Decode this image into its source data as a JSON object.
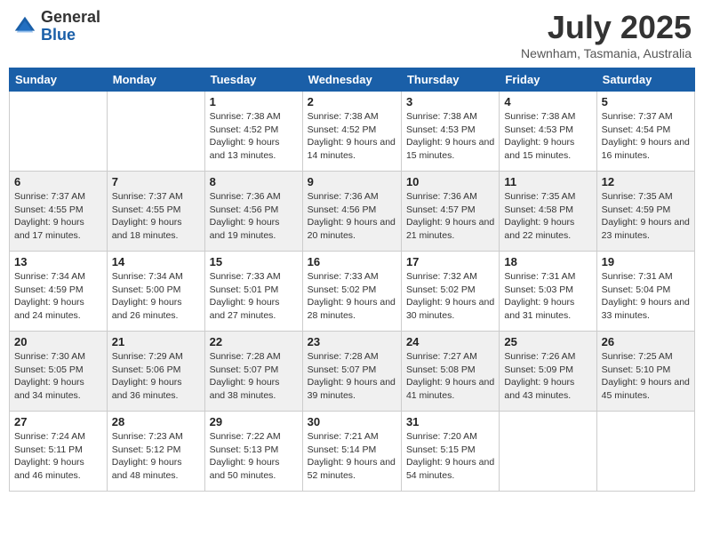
{
  "logo": {
    "general": "General",
    "blue": "Blue"
  },
  "title": {
    "month_year": "July 2025",
    "location": "Newnham, Tasmania, Australia"
  },
  "days_of_week": [
    "Sunday",
    "Monday",
    "Tuesday",
    "Wednesday",
    "Thursday",
    "Friday",
    "Saturday"
  ],
  "weeks": [
    [
      {
        "day": "",
        "detail": ""
      },
      {
        "day": "",
        "detail": ""
      },
      {
        "day": "1",
        "sunrise": "7:38 AM",
        "sunset": "4:52 PM",
        "daylight": "9 hours and 13 minutes."
      },
      {
        "day": "2",
        "sunrise": "7:38 AM",
        "sunset": "4:52 PM",
        "daylight": "9 hours and 14 minutes."
      },
      {
        "day": "3",
        "sunrise": "7:38 AM",
        "sunset": "4:53 PM",
        "daylight": "9 hours and 15 minutes."
      },
      {
        "day": "4",
        "sunrise": "7:38 AM",
        "sunset": "4:53 PM",
        "daylight": "9 hours and 15 minutes."
      },
      {
        "day": "5",
        "sunrise": "7:37 AM",
        "sunset": "4:54 PM",
        "daylight": "9 hours and 16 minutes."
      }
    ],
    [
      {
        "day": "6",
        "sunrise": "7:37 AM",
        "sunset": "4:55 PM",
        "daylight": "9 hours and 17 minutes."
      },
      {
        "day": "7",
        "sunrise": "7:37 AM",
        "sunset": "4:55 PM",
        "daylight": "9 hours and 18 minutes."
      },
      {
        "day": "8",
        "sunrise": "7:36 AM",
        "sunset": "4:56 PM",
        "daylight": "9 hours and 19 minutes."
      },
      {
        "day": "9",
        "sunrise": "7:36 AM",
        "sunset": "4:56 PM",
        "daylight": "9 hours and 20 minutes."
      },
      {
        "day": "10",
        "sunrise": "7:36 AM",
        "sunset": "4:57 PM",
        "daylight": "9 hours and 21 minutes."
      },
      {
        "day": "11",
        "sunrise": "7:35 AM",
        "sunset": "4:58 PM",
        "daylight": "9 hours and 22 minutes."
      },
      {
        "day": "12",
        "sunrise": "7:35 AM",
        "sunset": "4:59 PM",
        "daylight": "9 hours and 23 minutes."
      }
    ],
    [
      {
        "day": "13",
        "sunrise": "7:34 AM",
        "sunset": "4:59 PM",
        "daylight": "9 hours and 24 minutes."
      },
      {
        "day": "14",
        "sunrise": "7:34 AM",
        "sunset": "5:00 PM",
        "daylight": "9 hours and 26 minutes."
      },
      {
        "day": "15",
        "sunrise": "7:33 AM",
        "sunset": "5:01 PM",
        "daylight": "9 hours and 27 minutes."
      },
      {
        "day": "16",
        "sunrise": "7:33 AM",
        "sunset": "5:02 PM",
        "daylight": "9 hours and 28 minutes."
      },
      {
        "day": "17",
        "sunrise": "7:32 AM",
        "sunset": "5:02 PM",
        "daylight": "9 hours and 30 minutes."
      },
      {
        "day": "18",
        "sunrise": "7:31 AM",
        "sunset": "5:03 PM",
        "daylight": "9 hours and 31 minutes."
      },
      {
        "day": "19",
        "sunrise": "7:31 AM",
        "sunset": "5:04 PM",
        "daylight": "9 hours and 33 minutes."
      }
    ],
    [
      {
        "day": "20",
        "sunrise": "7:30 AM",
        "sunset": "5:05 PM",
        "daylight": "9 hours and 34 minutes."
      },
      {
        "day": "21",
        "sunrise": "7:29 AM",
        "sunset": "5:06 PM",
        "daylight": "9 hours and 36 minutes."
      },
      {
        "day": "22",
        "sunrise": "7:28 AM",
        "sunset": "5:07 PM",
        "daylight": "9 hours and 38 minutes."
      },
      {
        "day": "23",
        "sunrise": "7:28 AM",
        "sunset": "5:07 PM",
        "daylight": "9 hours and 39 minutes."
      },
      {
        "day": "24",
        "sunrise": "7:27 AM",
        "sunset": "5:08 PM",
        "daylight": "9 hours and 41 minutes."
      },
      {
        "day": "25",
        "sunrise": "7:26 AM",
        "sunset": "5:09 PM",
        "daylight": "9 hours and 43 minutes."
      },
      {
        "day": "26",
        "sunrise": "7:25 AM",
        "sunset": "5:10 PM",
        "daylight": "9 hours and 45 minutes."
      }
    ],
    [
      {
        "day": "27",
        "sunrise": "7:24 AM",
        "sunset": "5:11 PM",
        "daylight": "9 hours and 46 minutes."
      },
      {
        "day": "28",
        "sunrise": "7:23 AM",
        "sunset": "5:12 PM",
        "daylight": "9 hours and 48 minutes."
      },
      {
        "day": "29",
        "sunrise": "7:22 AM",
        "sunset": "5:13 PM",
        "daylight": "9 hours and 50 minutes."
      },
      {
        "day": "30",
        "sunrise": "7:21 AM",
        "sunset": "5:14 PM",
        "daylight": "9 hours and 52 minutes."
      },
      {
        "day": "31",
        "sunrise": "7:20 AM",
        "sunset": "5:15 PM",
        "daylight": "9 hours and 54 minutes."
      },
      {
        "day": "",
        "detail": ""
      },
      {
        "day": "",
        "detail": ""
      }
    ]
  ],
  "labels": {
    "sunrise": "Sunrise:",
    "sunset": "Sunset:",
    "daylight": "Daylight:"
  }
}
